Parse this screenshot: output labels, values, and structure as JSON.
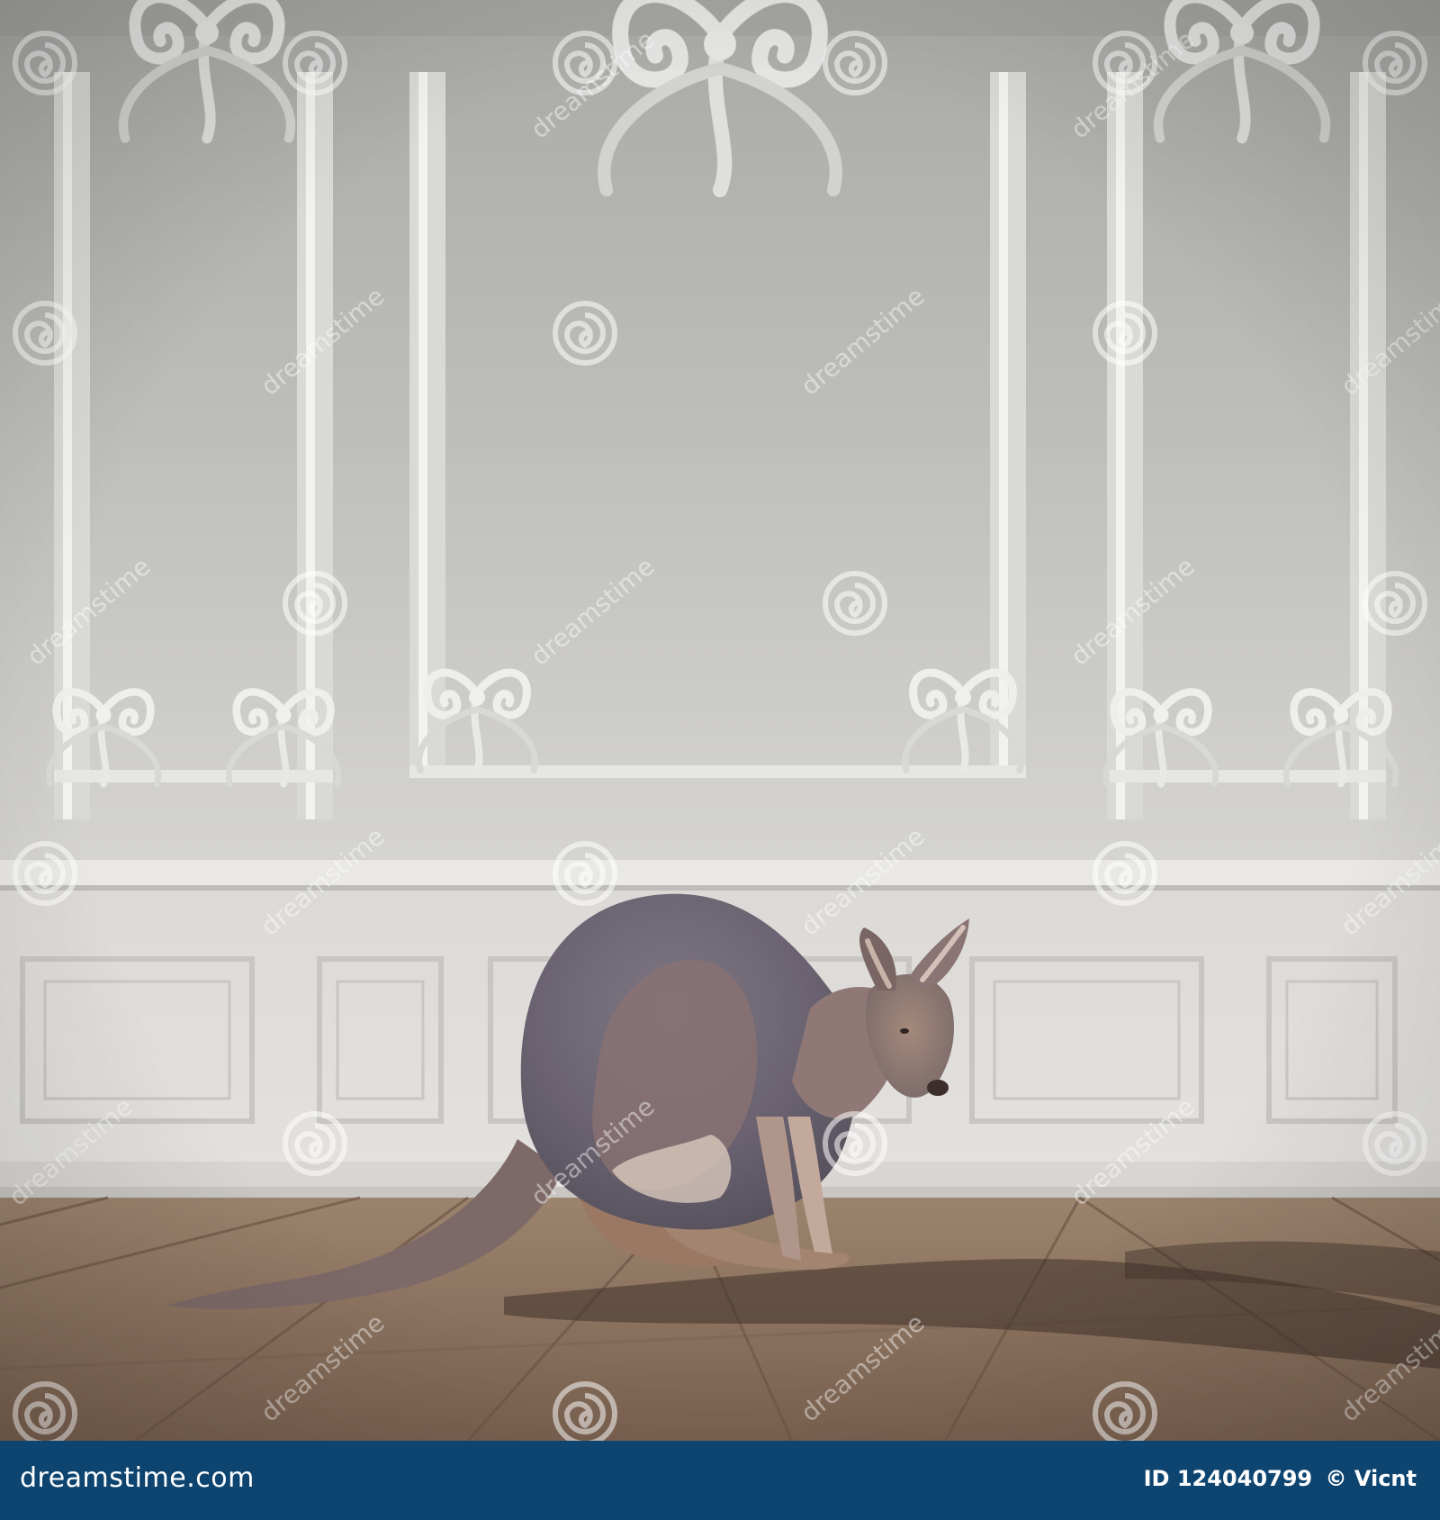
{
  "photo": {
    "subject": "kangaroo",
    "colors": {
      "wall": "#cfcfcc",
      "wall_dark": "#a7a8a4",
      "molding": "#e5e5e3",
      "floor": "#8a6f58",
      "kangaroo_body": "#6f6772",
      "kangaroo_warm": "#9a7a68",
      "shadow": "#3f3129"
    }
  },
  "watermark": {
    "text": "dreamstime",
    "icon": "dreamstime-swirl-icon"
  },
  "footer": {
    "brand": "dreamstime.com",
    "image_id": "ID 124040799",
    "credit": "© Vicnt",
    "colors": {
      "background": "#0e4570",
      "text": "#ffffff"
    }
  }
}
